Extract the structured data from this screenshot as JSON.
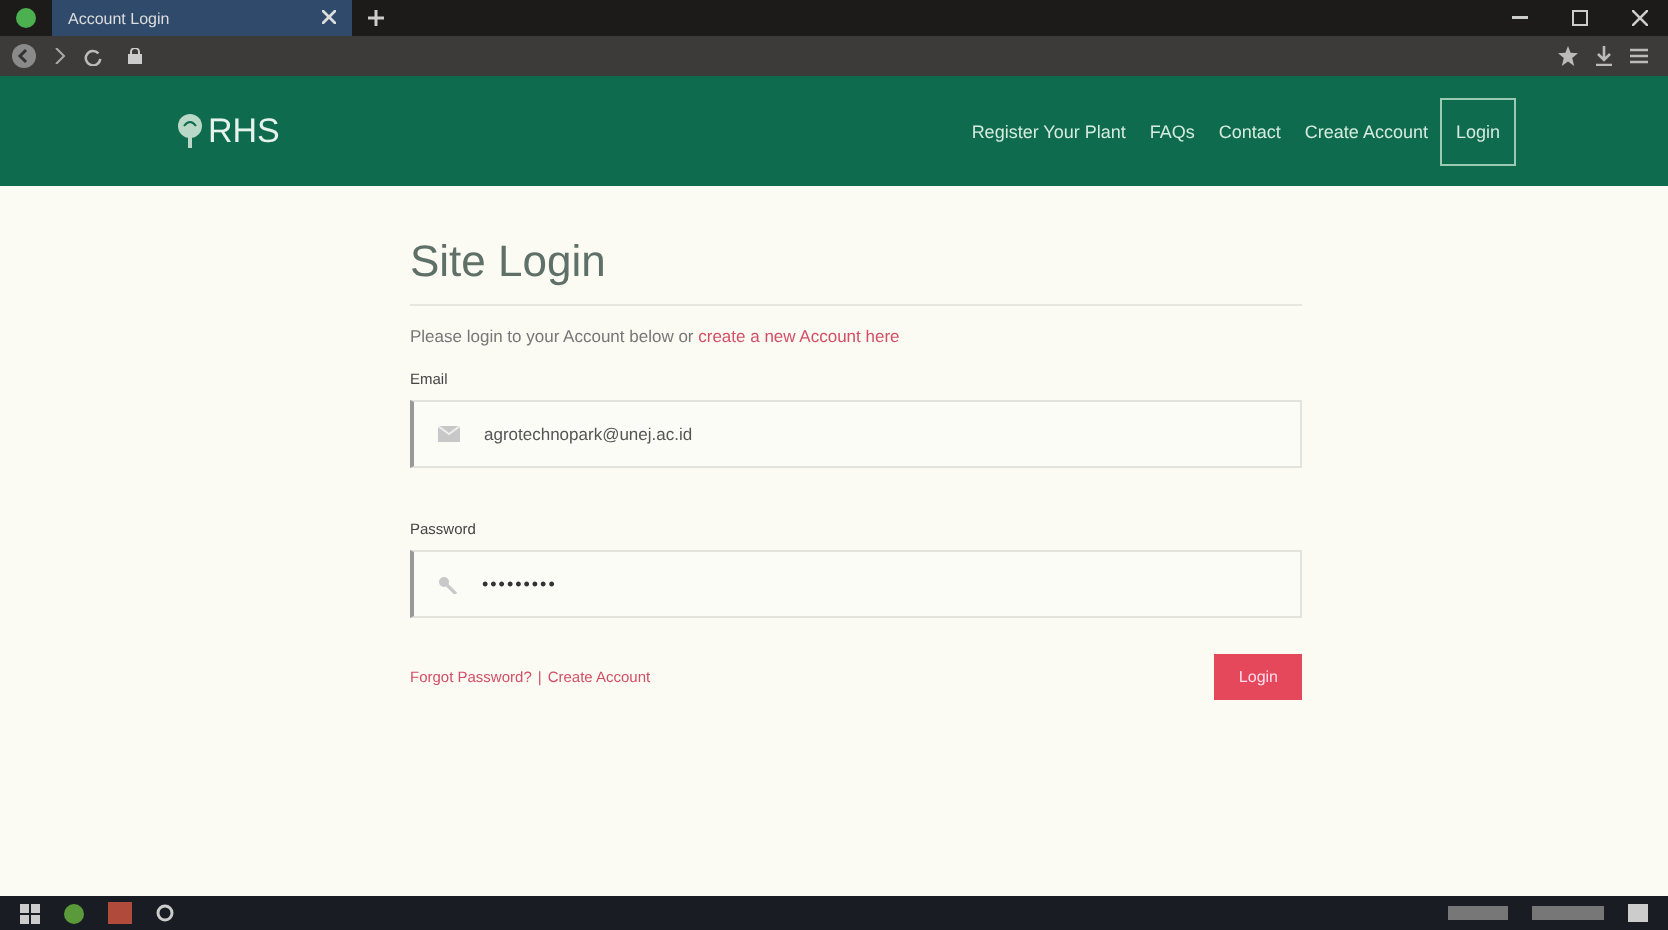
{
  "browser": {
    "tab_title": "Account Login"
  },
  "header": {
    "logo": "RHS",
    "nav": [
      {
        "label": "Register Your Plant",
        "selected": false
      },
      {
        "label": "FAQs",
        "selected": false
      },
      {
        "label": "Contact",
        "selected": false
      },
      {
        "label": "Create Account",
        "selected": false
      },
      {
        "label": "Login",
        "selected": true
      }
    ]
  },
  "login": {
    "title": "Site Login",
    "intro": "Please login to your Account below or ",
    "intro_link": "create a new Account here",
    "fields": [
      {
        "label": "Email",
        "kind": "email",
        "value": "agrotechnopark@unej.ac.id"
      },
      {
        "label": "Password",
        "kind": "password",
        "value": "•••••••••"
      }
    ],
    "links": [
      "Forgot Password?",
      "Create Account"
    ],
    "link_separator": "|",
    "submit": "Login"
  }
}
